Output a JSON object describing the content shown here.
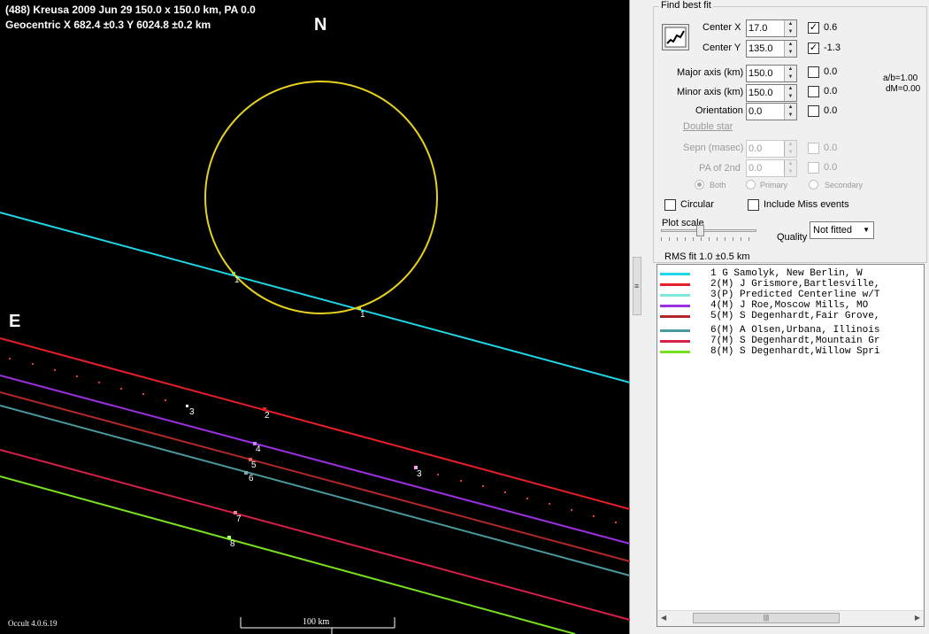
{
  "plot": {
    "title_line1": "(488) Kreusa  2009 Jun 29   150.0 x 150.0 km, PA 0.0",
    "title_line2": "Geocentric  X  682.4 ±0.3  Y 6024.8 ±0.2 km",
    "north_label": "N",
    "east_label": "E",
    "version": "Occult 4.0.6.19",
    "scale_label": "100 km",
    "chord_labels": [
      "1",
      "1",
      "3",
      "2",
      "4",
      "5",
      "6",
      "3",
      "7",
      "8"
    ],
    "colors": {
      "background": "#000000",
      "limb": "#e6d21e",
      "chord1": "#1ed8e8",
      "chord2": "#e81e28",
      "chord4": "#9a30e0",
      "chord5": "#b02828",
      "chord6": "#4a9aa0",
      "chord7": "#d8204a",
      "chord8": "#78e020",
      "predicted": "#e83c3c"
    }
  },
  "panel": {
    "group_title": "Find best fit",
    "center_x": {
      "label": "Center X",
      "value": "17.0",
      "checked": "✓",
      "result": "0.6"
    },
    "center_y": {
      "label": "Center Y",
      "value": "135.0",
      "checked": "✓",
      "result": "-1.3"
    },
    "major_axis": {
      "label": "Major axis (km)",
      "value": "150.0",
      "result": "0.0"
    },
    "minor_axis": {
      "label": "Minor axis (km)",
      "value": "150.0",
      "result": "0.0"
    },
    "orientation": {
      "label": "Orientation",
      "value": "0.0",
      "result": "0.0"
    },
    "ratio": "a/b=1.00",
    "dm": "dM=0.00",
    "double_star": "Double star",
    "sepn": {
      "label": "Sepn (masec)",
      "value": "0.0",
      "result": "0.0"
    },
    "pa2": {
      "label": "PA of 2nd",
      "value": "0.0",
      "result": "0.0"
    },
    "radios": [
      "Both",
      "Primary",
      "Secondary"
    ],
    "circular": "Circular",
    "include_miss": "Include Miss events",
    "plot_scale": "Plot scale",
    "quality_label": "Quality",
    "quality_value": "Not fitted",
    "rms": "RMS fit  1.0 ±0.5 km"
  },
  "observers": [
    {
      "text": "1      G Samolyk, New Berlin, W",
      "color": "#1ed8e8"
    },
    {
      "text": "2(M)  J Grismore,Bartlesville,",
      "color": "#e81e28"
    },
    {
      "text": "3(P)  Predicted Centerline w/T",
      "color": "#7ee8d8"
    },
    {
      "text": "4(M)  J Roe,Moscow Mills, MO",
      "color": "#9a30e0"
    },
    {
      "text": "5(M)  S Degenhardt,Fair Grove,",
      "color": "#b02828"
    },
    {
      "text": "6(M)  A Olsen,Urbana, Illinois",
      "color": "#4a9aa0"
    },
    {
      "text": "7(M)  S Degenhardt,Mountain Gr",
      "color": "#d8204a"
    },
    {
      "text": "8(M)  S Degenhardt,Willow Spri",
      "color": "#78e020"
    }
  ]
}
